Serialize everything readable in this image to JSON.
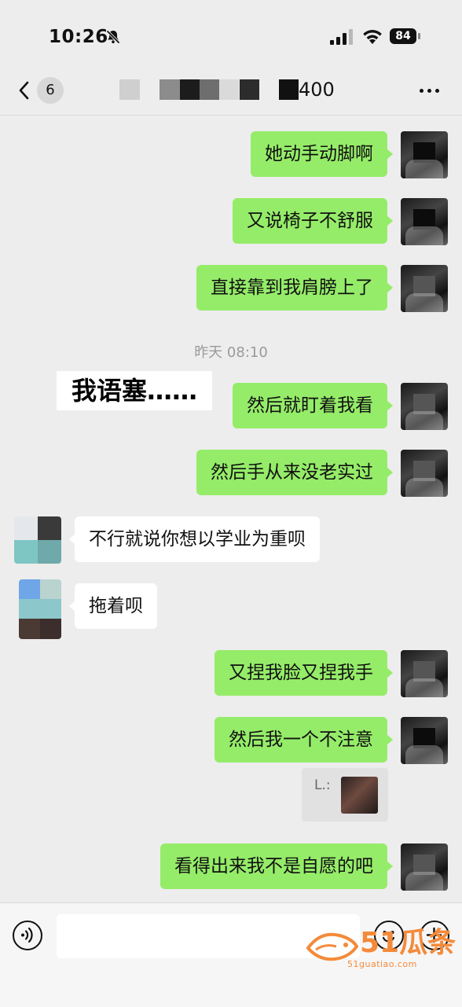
{
  "status_bar": {
    "time": "10:26",
    "battery": "84"
  },
  "nav": {
    "back_count": "6",
    "title_suffix": "400"
  },
  "messages": [
    {
      "text": "她动手动脚啊"
    },
    {
      "text": "又说椅子不舒服"
    },
    {
      "text": "直接靠到我肩膀上了"
    },
    {
      "text": "然后就盯着我看"
    },
    {
      "text": "然后手从来没老实过"
    },
    {
      "text": "不行就说你想以学业为重呗"
    },
    {
      "text": "拖着呗"
    },
    {
      "text": "又捏我脸又捏我手"
    },
    {
      "text": "然后我一个不注意"
    },
    {
      "text": "看得出来我不是自愿的吧"
    }
  ],
  "timestamp": "昨天 08:10",
  "caption": "我语塞……",
  "quote": {
    "label": "L.:"
  },
  "input": {
    "placeholder": ""
  },
  "watermark": {
    "brand": "51瓜条",
    "url": "51guatiao.com"
  },
  "colors": {
    "outgoing_bubble": "#95ec69",
    "incoming_bubble": "#ffffff",
    "background": "#ededed"
  },
  "icons": [
    "bell-mute-icon",
    "signal-icon",
    "wifi-icon",
    "battery-icon",
    "back-chevron-icon",
    "more-icon",
    "voice-icon",
    "emoji-icon",
    "plus-icon"
  ]
}
